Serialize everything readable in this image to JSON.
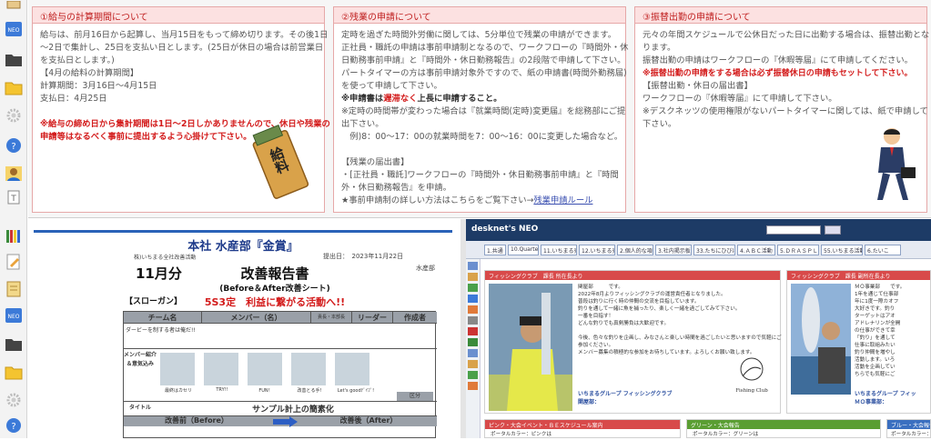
{
  "notices": [
    {
      "title": "①給与の計算期間について",
      "lines": [
        "給与は、前月16日から起算し、当月15日をもって締め切ります。その後1日",
        "〜2日で集計し、25日を支払い日とします。(25日が休日の場合は前営業日",
        "を支払日とします。)",
        "【4月の給料の計算期間】",
        "計算期間：3月16日〜4月15日",
        "支払日：4月25日"
      ],
      "warning": [
        "※給与の締め日から集計期間は1日〜2日しかありませんので、休日や残業の",
        "申請等はなるべく事前に提出するよう心掛けて下さい。"
      ],
      "illustration_label": "給料"
    },
    {
      "title": "②残業の申請について",
      "lines": [
        "定時を過ぎた時間外労働に関しては、5分単位で残業の申請ができます。",
        "正社員・職託の申請は事前申請制となるので、ワークフローの『時間外・休",
        "日勤務事前申請』と『時間外・休日勤務報告』の2段階で申請して下さい。",
        "パートタイマーの方は事前申請対象外ですので、紙の申請書(時間外勤務届)",
        "を使って申請して下さい。"
      ],
      "important_prefix": "※申請書は",
      "important_red": "遅滞なく",
      "important_suffix": "上長に申請すること。",
      "lines2": [
        "※定時の時間帯が変わった場合は『就業時間(定時)変更届』を総務部にご提",
        "出下さい。",
        "　例)8：00〜17：00の就業時間を7：00〜16：00に変更した場合など。",
        "",
        "【残業の届出書】",
        "・[正社員・職託]ワークフローの『時間外・休日勤務事前申請』と『時間",
        "外・休日勤務報告』を申請。"
      ],
      "link_prefix": "★事前申請制の詳しい方法はこちらをご覧下さい→",
      "link_text": "残業申請ルール"
    },
    {
      "title": "③振替出勤の申請について",
      "lines": [
        "元々の年間スケジュールで公休日だった日に出勤する場合は、振替出勤とな",
        "ります。",
        "振替出勤の申請はワークフローの『休暇等届』にて申請してください。"
      ],
      "warning": "※振替出勤の申請をする場合は必ず振替休日の申請もセットして下さい。",
      "lines2": [
        "【振替出勤・休日の届出書】",
        "ワークフローの『休暇等届』にて申請して下さい。",
        "※デスクネッツの使用権限がないパートタイマーに関しては、紙で申請して",
        "下さい。"
      ]
    }
  ],
  "report": {
    "header": "本社 水産部『金賞』",
    "month": "11月分",
    "submit_label": "提出日：",
    "submit_date": "2023年11月22日",
    "dept": "水産部",
    "top_note": "株)いちまる全社改善活動",
    "title": "改善報告書",
    "subtitle": "(Before＆After改善シート)",
    "slogan_label": "【スローガン】",
    "slogan": "5S3定　利益に繋がる活動へ!!",
    "col_team": "チーム名",
    "col_member": "メンバー（名）",
    "col_leader": "リーダー",
    "col_author": "作成者",
    "col_small": "責長・本部長",
    "team_name": "ダービーを制する者は俺だ!!",
    "member_label": "メンバー紹介＆意気込み",
    "members": [
      "最終はカセリ",
      "TRY!!",
      "FUN！",
      "改善とる手!",
      "Let's goodﾃﾞｲﾌﾞ!"
    ],
    "section_label": "区分",
    "title_label": "タイトル",
    "theme": "サンプル計上の簡素化",
    "before": "改善前（Before）",
    "after": "改善後（After）"
  },
  "desknets": {
    "logo": "desknet's NEO",
    "tabs": [
      "1.共通",
      "10.Quarterly",
      "11.いちまる売上",
      "12.いちまる売上",
      "2.個人的な項目",
      "3.社内掲示板",
      "33.たちにひびけ",
      "4.ＡＢＣ活動",
      "5.ＤＲＡＳＰＬＹ",
      "55.いちまる活動",
      "6.たいこ"
    ],
    "card1_header": "フィッシングクラブ　課長 所在長より",
    "card1_lines": [
      "関屋部　　　です。",
      "2022年8月よりフィッシングクラブの運営責任者となりました。",
      "普段は釣りに行く時の仲間の交流を目指しています。",
      "釣りを通して一緒に魚を捕ったり、楽しく一緒を過ごしてみて下さい。",
      "一番を目指す！",
      "どんな釣りでも真剣勝負は大歓迎です。",
      "",
      "今後、色々な釣りを企画し、みなさんと楽しい時間を過ごしたいと思いますので気軽にご",
      "参加ください。",
      "メンバー募集の積極的な参加をお待ちしています。よろしくお願い致します。"
    ],
    "card1_footer": "いちまるグループ フィッシングクラブ",
    "card1_footer2": "関屋部：",
    "club_label": "Fishing Club",
    "card2_header": "フィッシングクラブ　課長 副所在長より",
    "card2_lines": [
      "ＭＯ事業部　　です。",
      "1年を通じて仕事部",
      "年に1度一際カオフ",
      "大好きです。釣り",
      "ターゲットはアオ",
      "アドレナリンが全開",
      "の仕事ができて幸",
      "「釣り」を通して",
      "仕事に取組みたい",
      "釣り仲間を増やし",
      "活動します。いろ",
      "活動を企画してい",
      "ちらでも気軽にご"
    ],
    "card2_footer": "いちまるグループ フィッ",
    "card2_footer2": "ＭＯ事業部：",
    "bottom_left_header": "ピンク・大会イベント・ＢＥスケジュール案内",
    "bottom_left_text": "ポータルカラー：ピンクは",
    "bottom_mid_header": "グリーン・大会報告",
    "bottom_mid_text": "ポータルカラー：グリーンは",
    "bottom_right_header": "ブルー・大会報告",
    "bottom_right_text": "ポータルカラー：",
    "colors": {
      "header": "#1d3b66",
      "red": "#d84a4a",
      "green": "#5a9e32",
      "blue": "#3a6fc0"
    }
  },
  "sidebar_icons": [
    "sheet-icon",
    "neo-icon",
    "folder-black-icon",
    "folder-yellow-icon",
    "gear-icon",
    "help-icon",
    "user-icon",
    "text-icon",
    "books-icon",
    "pencil-icon",
    "document-icon",
    "neo-icon",
    "folder-black-icon",
    "folder-yellow-icon",
    "gear-icon",
    "help-icon"
  ]
}
